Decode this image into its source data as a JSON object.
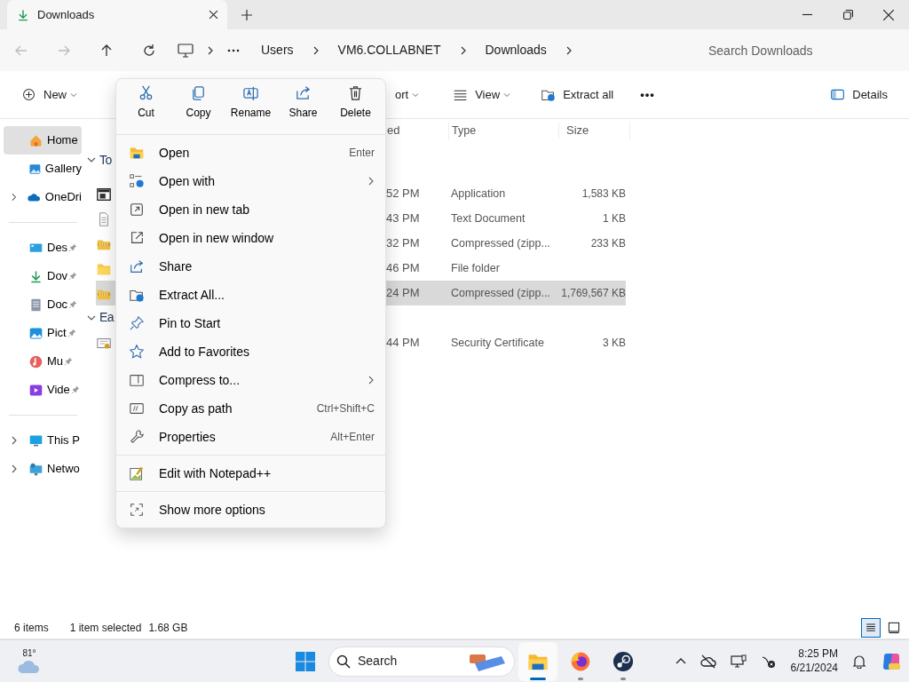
{
  "tab": {
    "title": "Downloads"
  },
  "address": {
    "crumbs": [
      "Users",
      "VM6.COLLABNET",
      "Downloads"
    ]
  },
  "search": {
    "placeholder": "Search Downloads"
  },
  "commands": [
    {
      "kind": "new",
      "label": "New",
      "dropdown": true
    },
    {
      "kind": "sort",
      "label": "ort",
      "dropdown": true
    },
    {
      "kind": "view",
      "label": "View",
      "dropdown": true
    },
    {
      "kind": "extract",
      "label": "Extract all",
      "dropdown": false
    },
    {
      "kind": "more",
      "label": "•••"
    }
  ],
  "details_button": "Details",
  "sidebar": {
    "groups": [
      [
        {
          "kind": "home",
          "label": "Home",
          "selected": true,
          "expandable": false,
          "pinned": false
        },
        {
          "kind": "gallery",
          "label": "Gallery",
          "selected": false,
          "expandable": false,
          "pinned": false
        },
        {
          "kind": "onedrive",
          "label": "OneDri",
          "selected": false,
          "expandable": true,
          "pinned": false
        }
      ],
      [
        {
          "kind": "desktop",
          "label": "Des",
          "selected": false,
          "expandable": false,
          "pinned": true
        },
        {
          "kind": "downloads",
          "label": "Dov",
          "selected": false,
          "expandable": false,
          "pinned": true
        },
        {
          "kind": "documents",
          "label": "Doc",
          "selected": false,
          "expandable": false,
          "pinned": true
        },
        {
          "kind": "pictures",
          "label": "Pict",
          "selected": false,
          "expandable": false,
          "pinned": true
        },
        {
          "kind": "music",
          "label": "Mu",
          "selected": false,
          "expandable": false,
          "pinned": true
        },
        {
          "kind": "videos",
          "label": "Vide",
          "selected": false,
          "expandable": false,
          "pinned": true
        }
      ],
      [
        {
          "kind": "pc",
          "label": "This P",
          "selected": false,
          "expandable": true,
          "pinned": false
        },
        {
          "kind": "network",
          "label": "Netwo",
          "selected": false,
          "expandable": true,
          "pinned": false
        }
      ]
    ]
  },
  "file_list": {
    "columns": [
      "ed",
      "Type",
      "Size"
    ],
    "groups": [
      {
        "label": "To",
        "expanded": true,
        "rows": [
          {
            "kind": "app",
            "date": "52 PM",
            "type": "Application",
            "size": "1,583 KB",
            "selected": false
          },
          {
            "kind": "text",
            "date": "43 PM",
            "type": "Text Document",
            "size": "1 KB",
            "selected": false
          },
          {
            "kind": "zip",
            "date": "32 PM",
            "type": "Compressed (zipp...",
            "size": "233 KB",
            "selected": false
          },
          {
            "kind": "folder",
            "date": "46 PM",
            "type": "File folder",
            "selected": false
          },
          {
            "kind": "zip",
            "date": "24 PM",
            "type": "Compressed (zipp...",
            "size": "1,769,567 KB",
            "selected": true
          }
        ]
      },
      {
        "label": "Ea",
        "expanded": true,
        "rows": [
          {
            "kind": "cert",
            "date": "44 PM",
            "type": "Security Certificate",
            "size": "3 KB",
            "selected": false
          }
        ]
      }
    ]
  },
  "context_menu": {
    "actions": [
      {
        "kind": "cut",
        "label": "Cut"
      },
      {
        "kind": "copy",
        "label": "Copy"
      },
      {
        "kind": "rename",
        "label": "Rename"
      },
      {
        "kind": "share",
        "label": "Share"
      },
      {
        "kind": "delete",
        "label": "Delete"
      }
    ],
    "sections": [
      [
        {
          "kind": "open",
          "label": "Open",
          "shortcut": "Enter",
          "submenu": false
        },
        {
          "kind": "openwith",
          "label": "Open with",
          "submenu": true
        },
        {
          "kind": "newtab",
          "label": "Open in new tab",
          "submenu": false
        },
        {
          "kind": "newwindow",
          "label": "Open in new window",
          "submenu": false
        },
        {
          "kind": "share",
          "label": "Share",
          "submenu": false
        },
        {
          "kind": "extract",
          "label": "Extract All...",
          "submenu": false
        },
        {
          "kind": "pin",
          "label": "Pin to Start",
          "submenu": false
        },
        {
          "kind": "star",
          "label": "Add to Favorites",
          "submenu": false
        },
        {
          "kind": "compress",
          "label": "Compress to...",
          "submenu": true
        },
        {
          "kind": "copypath",
          "label": "Copy as path",
          "shortcut": "Ctrl+Shift+C",
          "submenu": false
        },
        {
          "kind": "wrench",
          "label": "Properties",
          "shortcut": "Alt+Enter",
          "submenu": false
        }
      ],
      [
        {
          "kind": "notepad",
          "label": "Edit with Notepad++",
          "submenu": false
        }
      ],
      [
        {
          "kind": "more",
          "label": "Show more options",
          "submenu": false
        }
      ]
    ]
  },
  "status_bar": {
    "count": "6 items",
    "selection": "1 item selected",
    "size": "1.68 GB",
    "views": [
      {
        "kind": "details",
        "selected": true
      },
      {
        "kind": "tiles",
        "selected": false
      }
    ]
  },
  "taskbar": {
    "weather": "81°",
    "search": "Search",
    "apps": [
      {
        "kind": "explorer",
        "active": true
      },
      {
        "kind": "firefox",
        "active": false
      },
      {
        "kind": "steam",
        "active": false
      }
    ],
    "time": "8:25 PM",
    "date": "6/21/2024"
  }
}
